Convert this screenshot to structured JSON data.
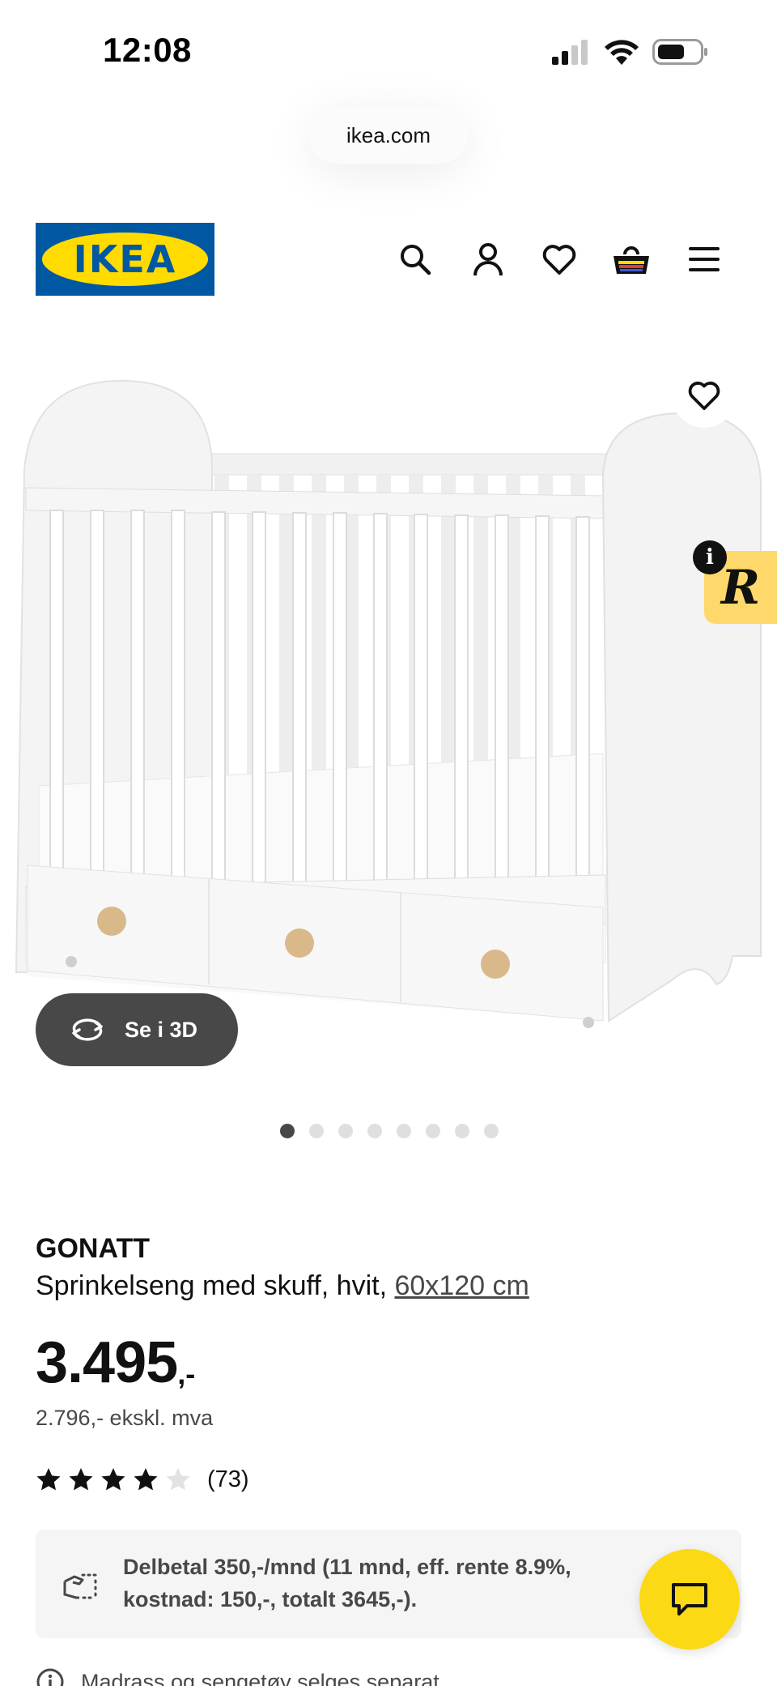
{
  "status_bar": {
    "time": "12:08"
  },
  "browser": {
    "url": "ikea.com"
  },
  "header": {
    "logo_text": "IKEA",
    "icons": [
      "search-icon",
      "account-icon",
      "heart-icon",
      "cart-icon",
      "menu-icon"
    ]
  },
  "gallery": {
    "view_3d_label": "Se i 3D",
    "badge_letter": "R",
    "info_letter": "i",
    "image_count": 8,
    "active_image_index": 0
  },
  "product": {
    "name": "GONATT",
    "description": "Sprinkelseng med skuff, hvit, ",
    "size": "60x120 cm",
    "price": "3.495",
    "price_suffix": ",-",
    "price_ex_vat": "2.796,- ekskl. mva",
    "rating": 4,
    "rating_max": 5,
    "review_count": "(73)"
  },
  "finance": {
    "text": "Delbetal 350,-/mnd (11 mnd, eff. rente 8.9%, kostnad: 150,-, totalt 3645,-)."
  },
  "note": {
    "text": "Madrass og sengetøy selges separat"
  },
  "colors": {
    "ikea_blue": "#0058a3",
    "ikea_yellow": "#ffdb00",
    "chat_yellow": "#fbd914",
    "dark_button": "#484848"
  }
}
